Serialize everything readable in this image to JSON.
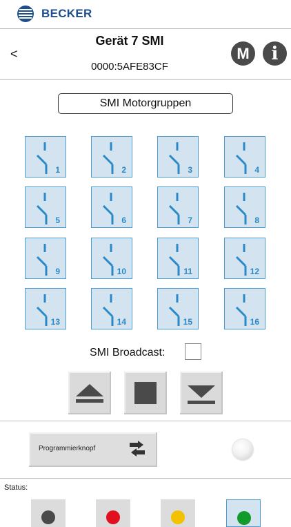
{
  "brand": {
    "name": "BECKER",
    "logo_icon": "becker-shutter-logo-icon",
    "color": "#1f4e8c"
  },
  "header": {
    "back_label": "<",
    "title": "Gerät 7 SMI",
    "device_id": "0000:5AFE83CF",
    "menu_button_label": "M",
    "info_button_label": "i"
  },
  "group": {
    "title": "SMI Motorgruppen"
  },
  "channels": [
    "1",
    "2",
    "3",
    "4",
    "5",
    "6",
    "7",
    "8",
    "9",
    "10",
    "11",
    "12",
    "13",
    "14",
    "15",
    "16"
  ],
  "channel_icon": "switch-open-icon",
  "broadcast": {
    "label": "SMI Broadcast:",
    "checked": false
  },
  "controls": {
    "up_icon": "eject-up-icon",
    "stop_icon": "stop-square-icon",
    "down_icon": "arrow-down-bar-icon"
  },
  "program": {
    "label": "Programmierknopf",
    "icon": "swap-arrows-icon",
    "led_state": "off"
  },
  "status": {
    "label": "Status:",
    "leds": [
      {
        "name": "dark",
        "color": "#4a4a4a"
      },
      {
        "name": "red",
        "color": "#e01020"
      },
      {
        "name": "yellow",
        "color": "#f2c200"
      },
      {
        "name": "green",
        "color": "#129a2a"
      }
    ]
  },
  "colors": {
    "tile_fill": "#d3e3f0",
    "tile_border": "#4a9bd2",
    "accent": "#2a8ac9"
  }
}
